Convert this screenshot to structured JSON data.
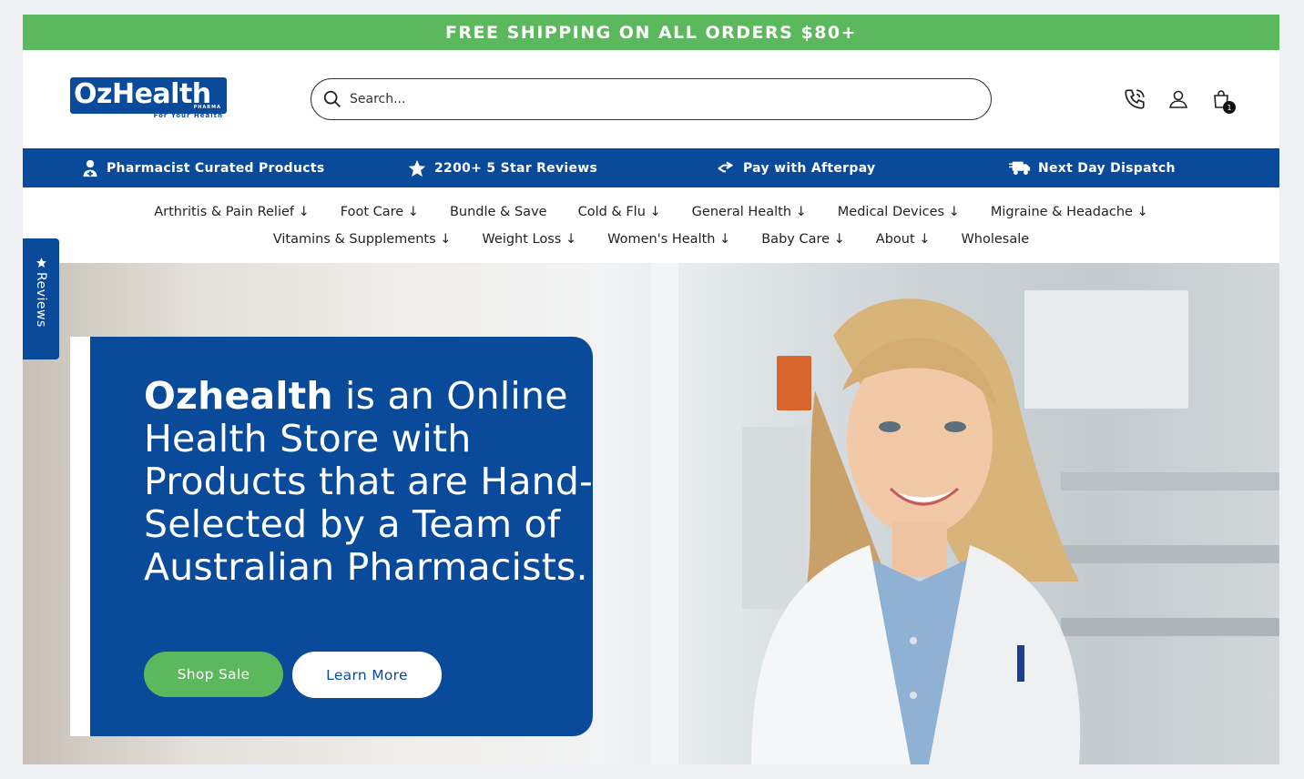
{
  "promo": {
    "text": "FREE SHIPPING ON ALL ORDERS $80+"
  },
  "header": {
    "logo": {
      "brand": "OzHealth",
      "sub": "PHARMA",
      "tagline": "For Your Health"
    },
    "search": {
      "placeholder": "Search..."
    },
    "icons": [
      "phone-icon",
      "account-icon",
      "cart-icon"
    ],
    "cart_count": "1"
  },
  "usp": [
    {
      "label": "Pharmacist Curated Products",
      "icon": "pharmacist-icon"
    },
    {
      "label": "2200+ 5 Star Reviews",
      "icon": "star-icon"
    },
    {
      "label": "Pay with Afterpay",
      "icon": "afterpay-icon"
    },
    {
      "label": "Next Day Dispatch",
      "icon": "truck-icon"
    }
  ],
  "nav": {
    "row1": [
      "Arthritis & Pain Relief ↓",
      "Foot Care ↓",
      "Bundle & Save",
      "Cold & Flu ↓",
      "General Health ↓",
      "Medical Devices ↓",
      "Migraine & Headache ↓"
    ],
    "row2": [
      "Vitamins & Supplements ↓",
      "Weight Loss ↓",
      "Women's Health ↓",
      "Baby Care ↓",
      "About ↓",
      "Wholesale"
    ]
  },
  "hero": {
    "headline_bold": "Ozhealth",
    "headline_rest": " is an Online Health Store with Products that are Hand-Selected by a Team of Australian Pharmacists.",
    "shop_label": "Shop Sale",
    "learn_label": "Learn More"
  },
  "reviews_tab": {
    "label": "Reviews"
  },
  "colors": {
    "brand_blue": "#0a4a9a",
    "accent_green": "#5cb85c"
  }
}
